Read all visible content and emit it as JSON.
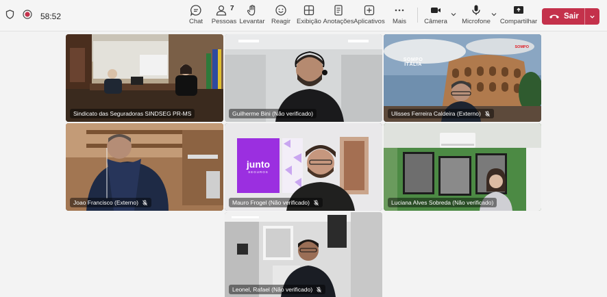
{
  "meeting": {
    "timer": "58:52"
  },
  "toolbar": {
    "chat": "Chat",
    "people": "Pessoas",
    "people_count": "7",
    "raise": "Levantar",
    "react": "Reagir",
    "view": "Exibição",
    "notes": "Anotações",
    "apps": "Aplicativos",
    "more": "Mais",
    "camera": "Câmera",
    "mic": "Microfone",
    "share": "Compartilhar",
    "leave": "Sair"
  },
  "participants": [
    {
      "name": "Sindicato das Seguradoras SINDSEG PR-MS"
    },
    {
      "name": "Guilherme Bini (Não verificado)"
    },
    {
      "name": "Ulisses Ferreira Caldeira (Externo)",
      "muted": true
    },
    {
      "name": "Joao Francisco (Externo)",
      "muted": true
    },
    {
      "name": "Mauro Frogel (Não verificado)",
      "muted": true
    },
    {
      "name": "Luciana Alves Sobreda (Não verificado)"
    },
    {
      "name": "Leonel, Rafael (Não verificado)",
      "muted": true
    }
  ],
  "backgrounds": {
    "sompo_title": "SOMPO ITÁLIA",
    "sompo_brand": "SOMPO",
    "junto_logo": "junto",
    "junto_sub": "SEGUROS"
  },
  "colors": {
    "leave": "#c4314b",
    "junto_purple": "#9b2fe0"
  },
  "icons": [
    "shield-icon",
    "record-icon",
    "chat-icon",
    "people-icon",
    "hand-icon",
    "emoji-icon",
    "layout-icon",
    "notes-icon",
    "apps-icon",
    "more-icon",
    "camera-icon",
    "mic-icon",
    "share-icon",
    "phone-icon",
    "chevron-down-icon",
    "mic-off-icon"
  ]
}
